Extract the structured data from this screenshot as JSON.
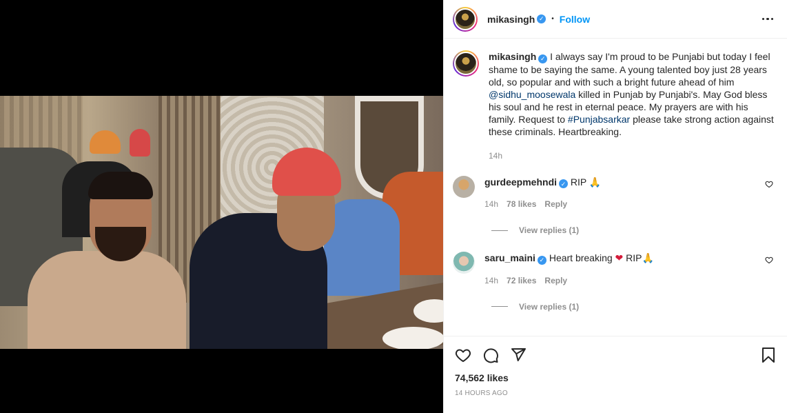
{
  "colors": {
    "accent": "#0095f6",
    "verified": "#3897f0",
    "muted": "#8e8e8e",
    "link": "#00376b"
  },
  "header": {
    "username": "mikasingh",
    "verified": true,
    "separator": "•",
    "follow_label": "Follow",
    "more_icon": "more-horizontal-icon"
  },
  "caption": {
    "username": "mikasingh",
    "text_1": "I always say I'm proud to be Punjabi but today I feel shame to be saying the same. A young talented boy just 28 years old, so popular and with such a bright future ahead of him ",
    "mention": "@sidhu_moosewala",
    "text_2": " killed in Punjab by Punjabi's. May God bless his soul and he rest in eternal peace. My prayers are with his family. Request to ",
    "hashtag": "#Punjabsarkar",
    "text_3": " please take strong action against these criminals. Heartbreaking.",
    "time": "14h"
  },
  "comments": [
    {
      "username": "gurdeepmehndi",
      "text": "RIP 🙏",
      "time": "14h",
      "likes": "78 likes",
      "reply_label": "Reply",
      "view_replies": "View replies (1)"
    },
    {
      "username": "saru_maini",
      "text_before": "Heart breaking ",
      "heart": "❤",
      "text_after": " RIP🙏",
      "time": "14h",
      "likes": "72 likes",
      "reply_label": "Reply",
      "view_replies": "View replies (1)"
    }
  ],
  "footer": {
    "icons": [
      "heart-icon",
      "comment-icon",
      "share-icon",
      "bookmark-icon"
    ],
    "likes": "74,562 likes",
    "time": "14 HOURS AGO"
  }
}
